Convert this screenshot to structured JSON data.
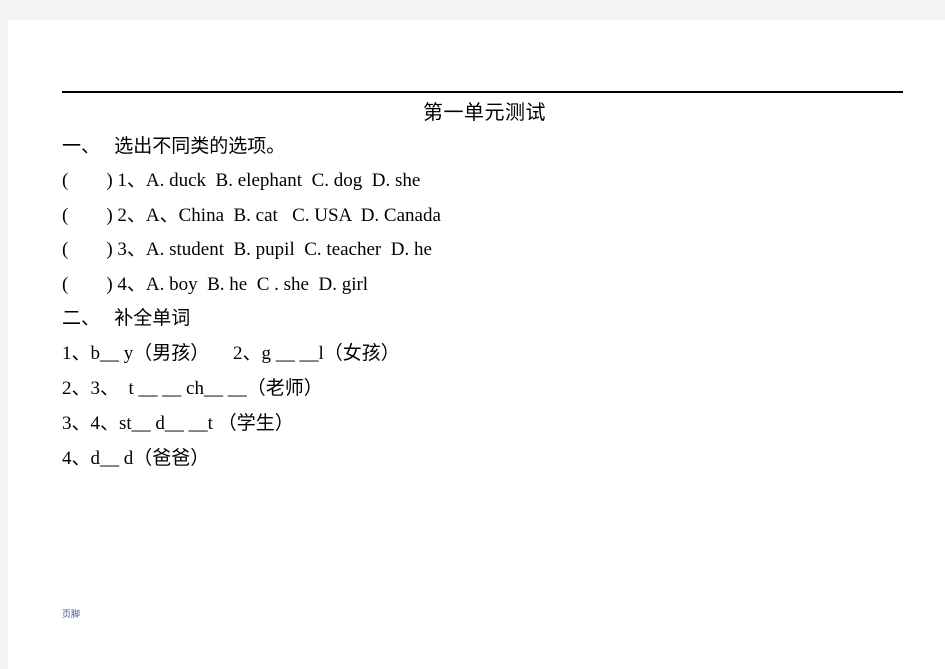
{
  "document": {
    "title": "第一单元测试",
    "sections": [
      {
        "heading": "一、   选出不同类的选项。",
        "questions": [
          "(        ) 1、A. duck  B. elephant  C. dog  D. she",
          "(        ) 2、A、China  B. cat   C. USA  D. Canada",
          "(        ) 3、A. student  B. pupil  C. teacher  D. he",
          "(        ) 4、A. boy  B. he  C . she  D. girl"
        ]
      },
      {
        "heading": "二、   补全单词",
        "questions": [
          "1、b__ y（男孩）     2、g __ __l（女孩）",
          "2、3、  t __ __ ch__ __（老师）",
          "3、4、st__ d__ __t （学生）",
          "4、d__ d（爸爸）"
        ]
      }
    ],
    "footer": "页脚"
  }
}
